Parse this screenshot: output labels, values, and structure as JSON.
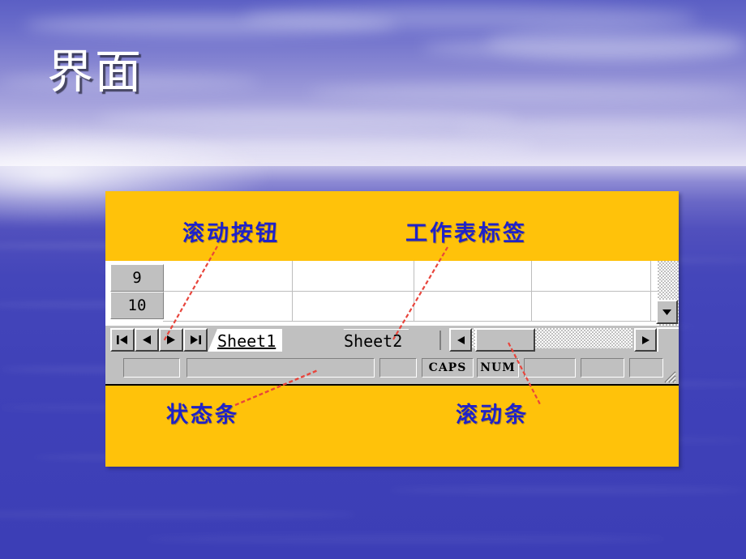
{
  "slide": {
    "title": "界面",
    "background_theme": "blue-sky-over-ocean",
    "colors": {
      "panel": "#ffc20a",
      "label_text": "#1f22c8",
      "title_text": "#ffffff",
      "leader_line": "#e8453c",
      "chrome_face": "#c0c0c0"
    }
  },
  "figure": {
    "labels": {
      "scroll_buttons": "滚动按钮",
      "sheet_tabs": "工作表标签",
      "status_bar": "状态条",
      "scroll_bar": "滚动条"
    }
  },
  "excel": {
    "row_headers": [
      "9",
      "10"
    ],
    "tab_nav_buttons": [
      {
        "name": "first",
        "glyph": "|◀"
      },
      {
        "name": "previous",
        "glyph": "◀"
      },
      {
        "name": "next",
        "glyph": "▶"
      },
      {
        "name": "last",
        "glyph": "▶|"
      }
    ],
    "sheet_tabs": [
      {
        "label": "Sheet1",
        "active": true
      },
      {
        "label": "Sheet2",
        "active": false
      }
    ],
    "hscroll": {
      "left_glyph": "◀",
      "right_glyph": "▶"
    },
    "vscroll": {
      "down_glyph": "▼"
    },
    "status_bar": {
      "panels": [
        "",
        "",
        "",
        "CAPS",
        "NUM",
        "",
        "",
        ""
      ],
      "caps_label": "CAPS",
      "num_label": "NUM"
    }
  }
}
